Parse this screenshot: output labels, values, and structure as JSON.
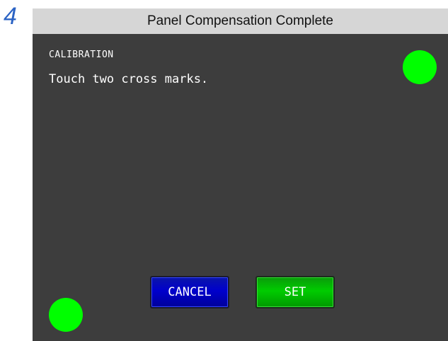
{
  "step": {
    "number": "4"
  },
  "header": {
    "title": "Panel Compensation Complete"
  },
  "screen": {
    "heading": "CALIBRATION",
    "instruction": "Touch two cross marks."
  },
  "buttons": {
    "cancel_label": "CANCEL",
    "set_label": "SET"
  },
  "colors": {
    "panel_bg": "#3d3d3d",
    "marker": "#00ff00",
    "cancel_button": "#0000cc",
    "set_button": "#00cc00",
    "step_number": "#2b63c4",
    "title_bar": "#d6d6d6"
  }
}
